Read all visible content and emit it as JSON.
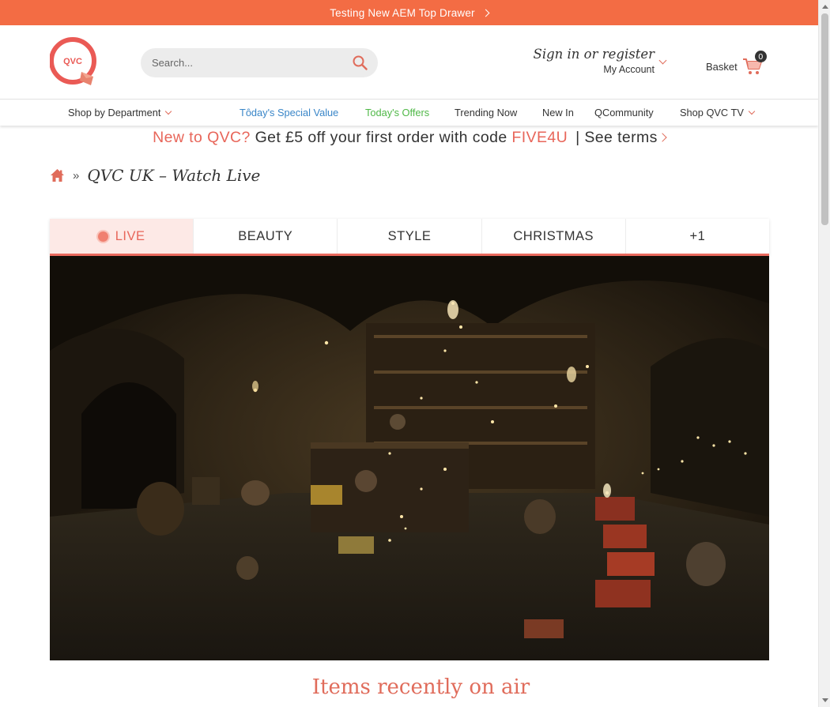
{
  "top_drawer": {
    "text": "Testing New AEM Top Drawer"
  },
  "header": {
    "logo_text": "QVC",
    "search_placeholder": "Search...",
    "account": {
      "sign_in": "Sign in or register",
      "my_account": "My Account"
    },
    "basket": {
      "label": "Basket",
      "count": "0"
    }
  },
  "nav": {
    "items": [
      {
        "label": "Shop by Department",
        "color": "#333333"
      },
      {
        "label": "Tôday's Special Value",
        "color": "#3a86c8"
      },
      {
        "label": "Today's Offers",
        "color": "#4fb847"
      },
      {
        "label": "Trending Now",
        "color": "#333333"
      },
      {
        "label": "New In",
        "color": "#333333"
      },
      {
        "label": "QCommunity",
        "color": "#333333"
      },
      {
        "label": "Shop QVC TV",
        "color": "#333333"
      }
    ]
  },
  "promo": {
    "part1": "New to QVC?",
    "part2": " Get £5 off your first order with code ",
    "code": "FIVE4U",
    "terms": "| See terms"
  },
  "breadcrumb": {
    "separator": "»",
    "title": "QVC UK – Watch Live"
  },
  "tabs": [
    {
      "label": "LIVE",
      "active": true
    },
    {
      "label": "BEAUTY",
      "active": false
    },
    {
      "label": "STYLE",
      "active": false
    },
    {
      "label": "CHRISTMAS",
      "active": false
    },
    {
      "label": "+1",
      "active": false
    }
  ],
  "recent_heading": "Items recently on air",
  "colors": {
    "brand_orange": "#f36c44",
    "brand_coral": "#e8665a"
  }
}
